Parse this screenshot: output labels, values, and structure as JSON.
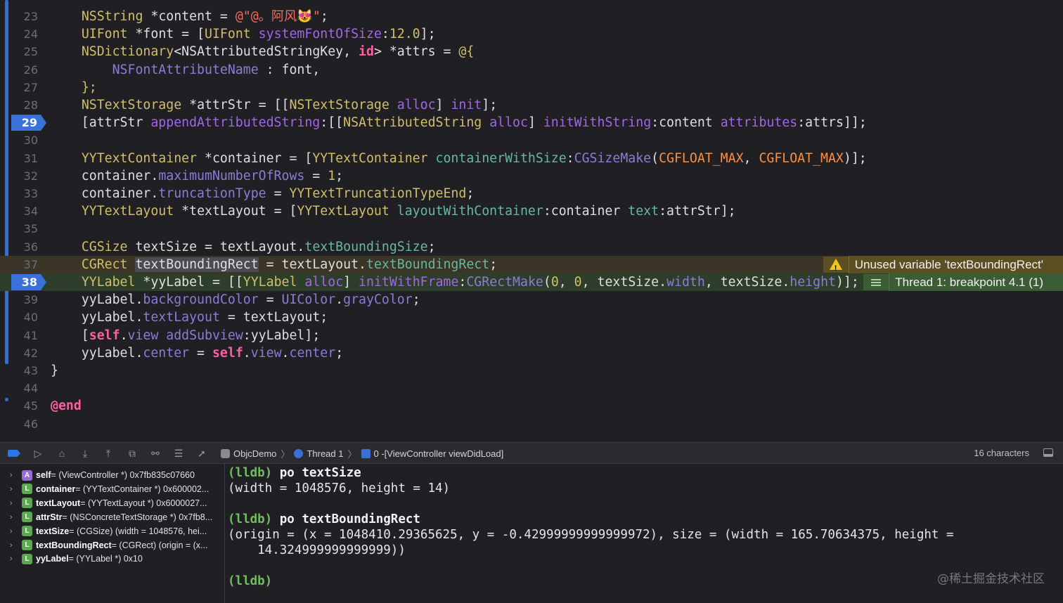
{
  "editor": {
    "lines": [
      {
        "num": "23",
        "tokens": [
          [
            "    ",
            "plain"
          ],
          [
            "NSString",
            "type"
          ],
          [
            " *content = ",
            "plain"
          ],
          [
            "@\"@。阿风😻\"",
            "str"
          ],
          [
            ";",
            "plain"
          ]
        ]
      },
      {
        "num": "24",
        "tokens": [
          [
            "    ",
            "plain"
          ],
          [
            "UIFont",
            "type"
          ],
          [
            " *font = [",
            "plain"
          ],
          [
            "UIFont",
            "type"
          ],
          [
            " ",
            "plain"
          ],
          [
            "systemFontOfSize",
            "method"
          ],
          [
            ":",
            "plain"
          ],
          [
            "12.0",
            "num"
          ],
          [
            "];",
            "plain"
          ]
        ]
      },
      {
        "num": "25",
        "tokens": [
          [
            "    ",
            "plain"
          ],
          [
            "NSDictionary",
            "type"
          ],
          [
            "<",
            "plain"
          ],
          [
            "NSAttributedStringKey",
            "plain"
          ],
          [
            ", ",
            "plain"
          ],
          [
            "id",
            "kw"
          ],
          [
            "> *attrs = ",
            "plain"
          ],
          [
            "@{",
            "type"
          ]
        ]
      },
      {
        "num": "26",
        "tokens": [
          [
            "        ",
            "plain"
          ],
          [
            "NSFontAttributeName",
            "prop"
          ],
          [
            " : font,",
            "plain"
          ]
        ]
      },
      {
        "num": "27",
        "tokens": [
          [
            "    ",
            "plain"
          ],
          [
            "};",
            "type"
          ]
        ]
      },
      {
        "num": "28",
        "tokens": [
          [
            "    ",
            "plain"
          ],
          [
            "NSTextStorage",
            "type"
          ],
          [
            " *attrStr = [[",
            "plain"
          ],
          [
            "NSTextStorage",
            "type"
          ],
          [
            " ",
            "plain"
          ],
          [
            "alloc",
            "method"
          ],
          [
            "] ",
            "plain"
          ],
          [
            "init",
            "method"
          ],
          [
            "];",
            "plain"
          ]
        ]
      },
      {
        "num": "29",
        "tokens": [
          [
            "    [attrStr ",
            "plain"
          ],
          [
            "appendAttributedString",
            "method"
          ],
          [
            ":[[",
            "plain"
          ],
          [
            "NSAttributedString",
            "type"
          ],
          [
            " ",
            "plain"
          ],
          [
            "alloc",
            "method"
          ],
          [
            "] ",
            "plain"
          ],
          [
            "initWithString",
            "method"
          ],
          [
            ":content ",
            "plain"
          ],
          [
            "attributes",
            "method"
          ],
          [
            ":attrs]];",
            "plain"
          ]
        ]
      },
      {
        "num": "30",
        "tokens": []
      },
      {
        "num": "31",
        "tokens": [
          [
            "    ",
            "plain"
          ],
          [
            "YYTextContainer",
            "type"
          ],
          [
            " *container = [",
            "plain"
          ],
          [
            "YYTextContainer",
            "type"
          ],
          [
            " ",
            "plain"
          ],
          [
            "containerWithSize",
            "green"
          ],
          [
            ":",
            "plain"
          ],
          [
            "CGSizeMake",
            "prop"
          ],
          [
            "(",
            "plain"
          ],
          [
            "CGFLOAT_MAX",
            "macro"
          ],
          [
            ", ",
            "plain"
          ],
          [
            "CGFLOAT_MAX",
            "macro"
          ],
          [
            ")];",
            "plain"
          ]
        ]
      },
      {
        "num": "32",
        "tokens": [
          [
            "    container.",
            "plain"
          ],
          [
            "maximumNumberOfRows",
            "prop"
          ],
          [
            " = ",
            "plain"
          ],
          [
            "1",
            "num"
          ],
          [
            ";",
            "plain"
          ]
        ]
      },
      {
        "num": "33",
        "tokens": [
          [
            "    container.",
            "plain"
          ],
          [
            "truncationType",
            "prop"
          ],
          [
            " = ",
            "plain"
          ],
          [
            "YYTextTruncationTypeEnd",
            "type"
          ],
          [
            ";",
            "plain"
          ]
        ]
      },
      {
        "num": "34",
        "tokens": [
          [
            "    ",
            "plain"
          ],
          [
            "YYTextLayout",
            "type"
          ],
          [
            " *textLayout = [",
            "plain"
          ],
          [
            "YYTextLayout",
            "type"
          ],
          [
            " ",
            "plain"
          ],
          [
            "layoutWithContainer",
            "green"
          ],
          [
            ":container ",
            "plain"
          ],
          [
            "text",
            "green"
          ],
          [
            ":attrStr];",
            "plain"
          ]
        ]
      },
      {
        "num": "35",
        "tokens": []
      },
      {
        "num": "36",
        "tokens": [
          [
            "    ",
            "plain"
          ],
          [
            "CGSize",
            "type"
          ],
          [
            " textSize = textLayout.",
            "plain"
          ],
          [
            "textBoundingSize",
            "green"
          ],
          [
            ";",
            "plain"
          ]
        ]
      },
      {
        "num": "37",
        "tokens": [
          [
            "    ",
            "plain"
          ],
          [
            "CGRect",
            "type"
          ],
          [
            " ",
            "plain"
          ],
          [
            "textBoundingRect",
            "sel"
          ],
          [
            " = textLayout.",
            "plain"
          ],
          [
            "textBoundingRect",
            "green"
          ],
          [
            ";",
            "plain"
          ]
        ]
      },
      {
        "num": "38",
        "tokens": [
          [
            "    ",
            "plain"
          ],
          [
            "YYLabel",
            "type"
          ],
          [
            " *yyLabel = [[",
            "plain"
          ],
          [
            "YYLabel",
            "type"
          ],
          [
            " ",
            "plain"
          ],
          [
            "alloc",
            "method"
          ],
          [
            "] ",
            "plain"
          ],
          [
            "initWithFrame",
            "method"
          ],
          [
            ":",
            "plain"
          ],
          [
            "CGRectMake",
            "prop"
          ],
          [
            "(",
            "plain"
          ],
          [
            "0",
            "num"
          ],
          [
            ", ",
            "plain"
          ],
          [
            "0",
            "num"
          ],
          [
            ", textSize.",
            "plain"
          ],
          [
            "width",
            "prop"
          ],
          [
            ", textSize.",
            "plain"
          ],
          [
            "height",
            "prop"
          ],
          [
            ")];",
            "plain"
          ]
        ]
      },
      {
        "num": "39",
        "tokens": [
          [
            "    yyLabel.",
            "plain"
          ],
          [
            "backgroundColor",
            "prop"
          ],
          [
            " = ",
            "plain"
          ],
          [
            "UIColor",
            "prop"
          ],
          [
            ".",
            "plain"
          ],
          [
            "grayColor",
            "prop"
          ],
          [
            ";",
            "plain"
          ]
        ]
      },
      {
        "num": "40",
        "tokens": [
          [
            "    yyLabel.",
            "plain"
          ],
          [
            "textLayout",
            "prop"
          ],
          [
            " = textLayout;",
            "plain"
          ]
        ]
      },
      {
        "num": "41",
        "tokens": [
          [
            "    [",
            "plain"
          ],
          [
            "self",
            "kw"
          ],
          [
            ".",
            "plain"
          ],
          [
            "view",
            "prop"
          ],
          [
            " ",
            "plain"
          ],
          [
            "addSubview",
            "prop"
          ],
          [
            ":yyLabel];",
            "plain"
          ]
        ]
      },
      {
        "num": "42",
        "tokens": [
          [
            "    yyLabel.",
            "plain"
          ],
          [
            "center",
            "prop"
          ],
          [
            " = ",
            "plain"
          ],
          [
            "self",
            "kw"
          ],
          [
            ".",
            "plain"
          ],
          [
            "view",
            "prop"
          ],
          [
            ".",
            "plain"
          ],
          [
            "center",
            "prop"
          ],
          [
            ";",
            "plain"
          ]
        ]
      },
      {
        "num": "43",
        "tokens": [
          [
            "}",
            "plain"
          ]
        ]
      },
      {
        "num": "44",
        "tokens": []
      },
      {
        "num": "45",
        "tokens": [
          [
            "@end",
            "kw"
          ]
        ]
      },
      {
        "num": "46",
        "tokens": []
      }
    ],
    "warning_text": "Unused variable 'textBoundingRect'",
    "breakpoint_text": "Thread 1: breakpoint 4.1 (1)"
  },
  "debugbar": {
    "app": "ObjcDemo",
    "thread": "Thread 1",
    "frame": "0 -[ViewController viewDidLoad]",
    "char_count": "16 characters"
  },
  "variables": [
    {
      "badge": "A",
      "name": "self",
      "value": " = (ViewController *) 0x7fb835c07660"
    },
    {
      "badge": "L",
      "name": "container",
      "value": " = (YYTextContainer *) 0x600002..."
    },
    {
      "badge": "L",
      "name": "textLayout",
      "value": " = (YYTextLayout *) 0x6000027..."
    },
    {
      "badge": "L",
      "name": "attrStr",
      "value": " = (NSConcreteTextStorage *) 0x7fb8..."
    },
    {
      "badge": "L",
      "name": "textSize",
      "value": " = (CGSize) (width = 1048576, hei..."
    },
    {
      "badge": "L",
      "name": "textBoundingRect",
      "value": " = (CGRect) (origin = (x..."
    },
    {
      "badge": "L",
      "name": "yyLabel",
      "value": " = (YYLabel *) 0x10"
    }
  ],
  "console": {
    "prompt": "(lldb)",
    "cmd1": " po textSize",
    "out1": "(width = 1048576, height = 14)",
    "cmd2": " po textBoundingRect",
    "out2a": "(origin = (x = 1048410.29365625, y = -0.42999999999999972), size = (width = 165.70634375, height =",
    "out2b": "    14.324999999999999))",
    "watermark": "@稀土掘金技术社区"
  }
}
